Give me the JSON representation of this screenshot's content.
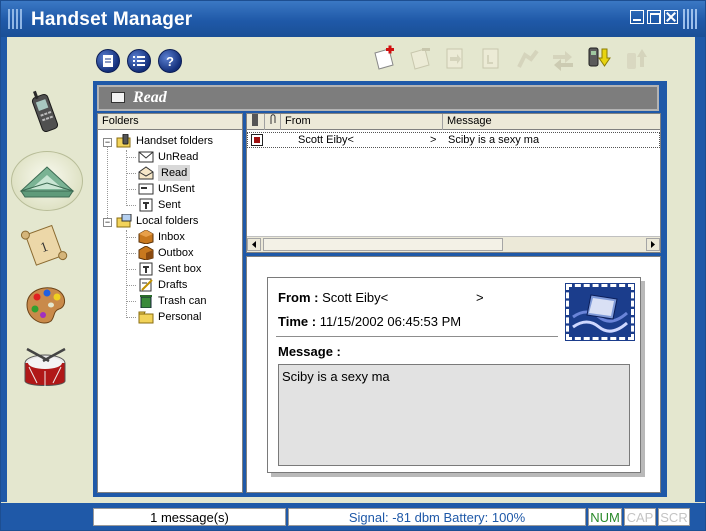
{
  "window": {
    "title": "Handset Manager"
  },
  "header": {
    "title": "Read"
  },
  "folders": {
    "header": "Folders",
    "handset_label": "Handset folders",
    "handset_items": [
      "UnRead",
      "Read",
      "UnSent",
      "Sent"
    ],
    "local_label": "Local folders",
    "local_items": [
      "Inbox",
      "Outbox",
      "Sent box",
      "Drafts",
      "Trash can",
      "Personal"
    ]
  },
  "list": {
    "col_from": "From",
    "col_message": "Message",
    "rows": [
      {
        "from": "Scott Eiby<",
        "from_tail": ">",
        "message": "Sciby is a sexy ma"
      }
    ]
  },
  "preview": {
    "from_label": "From :",
    "from_value": "Scott Eiby<",
    "from_tail": ">",
    "time_label": "Time :",
    "time_value": "11/15/2002 06:45:53 PM",
    "message_label": "Message :",
    "message_body": "Sciby is a sexy ma"
  },
  "status": {
    "count": "1 message(s)",
    "signal": "Signal: -81 dbm Battery: 100%",
    "num": "NUM",
    "cap": "CAP",
    "scr": "SCR"
  },
  "colors": {
    "frame": "#1f59a8",
    "background": "#e4e7cf",
    "header_gray": "#7d7d7d"
  }
}
